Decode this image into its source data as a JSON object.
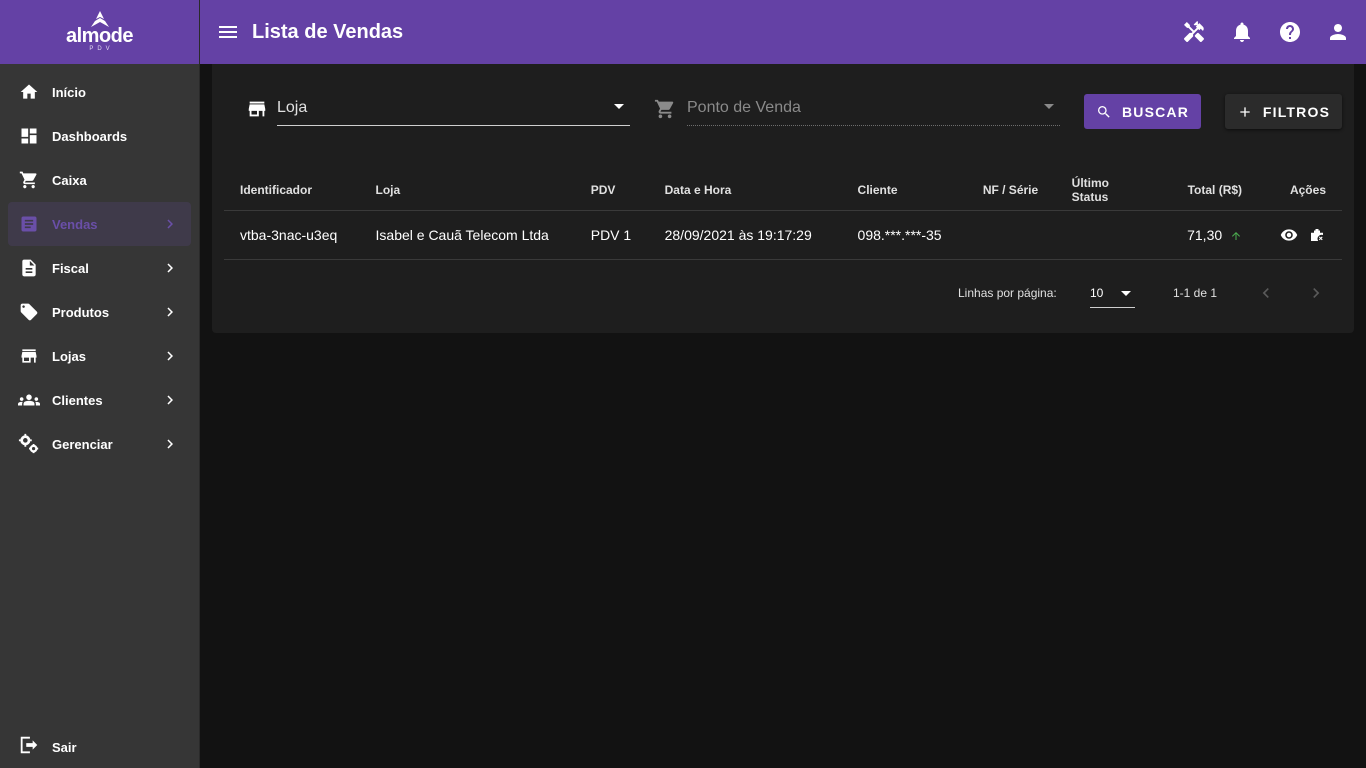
{
  "app": {
    "logo_text": "almode",
    "logo_sub": "PDV",
    "brand_color": "#6441a5"
  },
  "header": {
    "title": "Lista de Vendas",
    "icons": [
      "menu-icon",
      "tools-icon",
      "bell-icon",
      "help-icon",
      "account-icon"
    ]
  },
  "sidebar": {
    "items": [
      {
        "label": "Início",
        "icon": "home-icon",
        "has_children": false,
        "active": false
      },
      {
        "label": "Dashboards",
        "icon": "dashboard-icon",
        "has_children": false,
        "active": false
      },
      {
        "label": "Caixa",
        "icon": "cart-icon",
        "has_children": false,
        "active": false
      },
      {
        "label": "Vendas",
        "icon": "list-icon",
        "has_children": true,
        "active": true
      },
      {
        "label": "Fiscal",
        "icon": "document-icon",
        "has_children": true,
        "active": false
      },
      {
        "label": "Produtos",
        "icon": "tag-icon",
        "has_children": true,
        "active": false
      },
      {
        "label": "Lojas",
        "icon": "store-icon",
        "has_children": true,
        "active": false
      },
      {
        "label": "Clientes",
        "icon": "people-icon",
        "has_children": true,
        "active": false
      },
      {
        "label": "Gerenciar",
        "icon": "gears-icon",
        "has_children": true,
        "active": false
      }
    ],
    "logout_label": "Sair"
  },
  "filters": {
    "store": {
      "label": "Loja",
      "icon": "store-icon"
    },
    "pos": {
      "label": "Ponto de Venda",
      "icon": "cart-icon",
      "disabled": true
    },
    "search_button": "BUSCAR",
    "filters_button": "FILTROS"
  },
  "table": {
    "columns": [
      "Identificador",
      "Loja",
      "PDV",
      "Data e Hora",
      "Cliente",
      "NF / Série",
      "Último Status",
      "Total (R$)",
      "Ações"
    ],
    "rows": [
      {
        "id": "vtba-3nac-u3eq",
        "store": "Isabel e Cauã Telecom Ltda",
        "pdv": "PDV 1",
        "datetime": "28/09/2021 às 19:17:29",
        "client": "098.***.***-35",
        "nf_serie": "",
        "last_status": "",
        "total": "71,30",
        "trend": "up",
        "trend_color": "#4caf50"
      }
    ]
  },
  "pagination": {
    "rows_per_page_label": "Linhas por página:",
    "rows_per_page": "10",
    "range": "1-1 de 1"
  }
}
